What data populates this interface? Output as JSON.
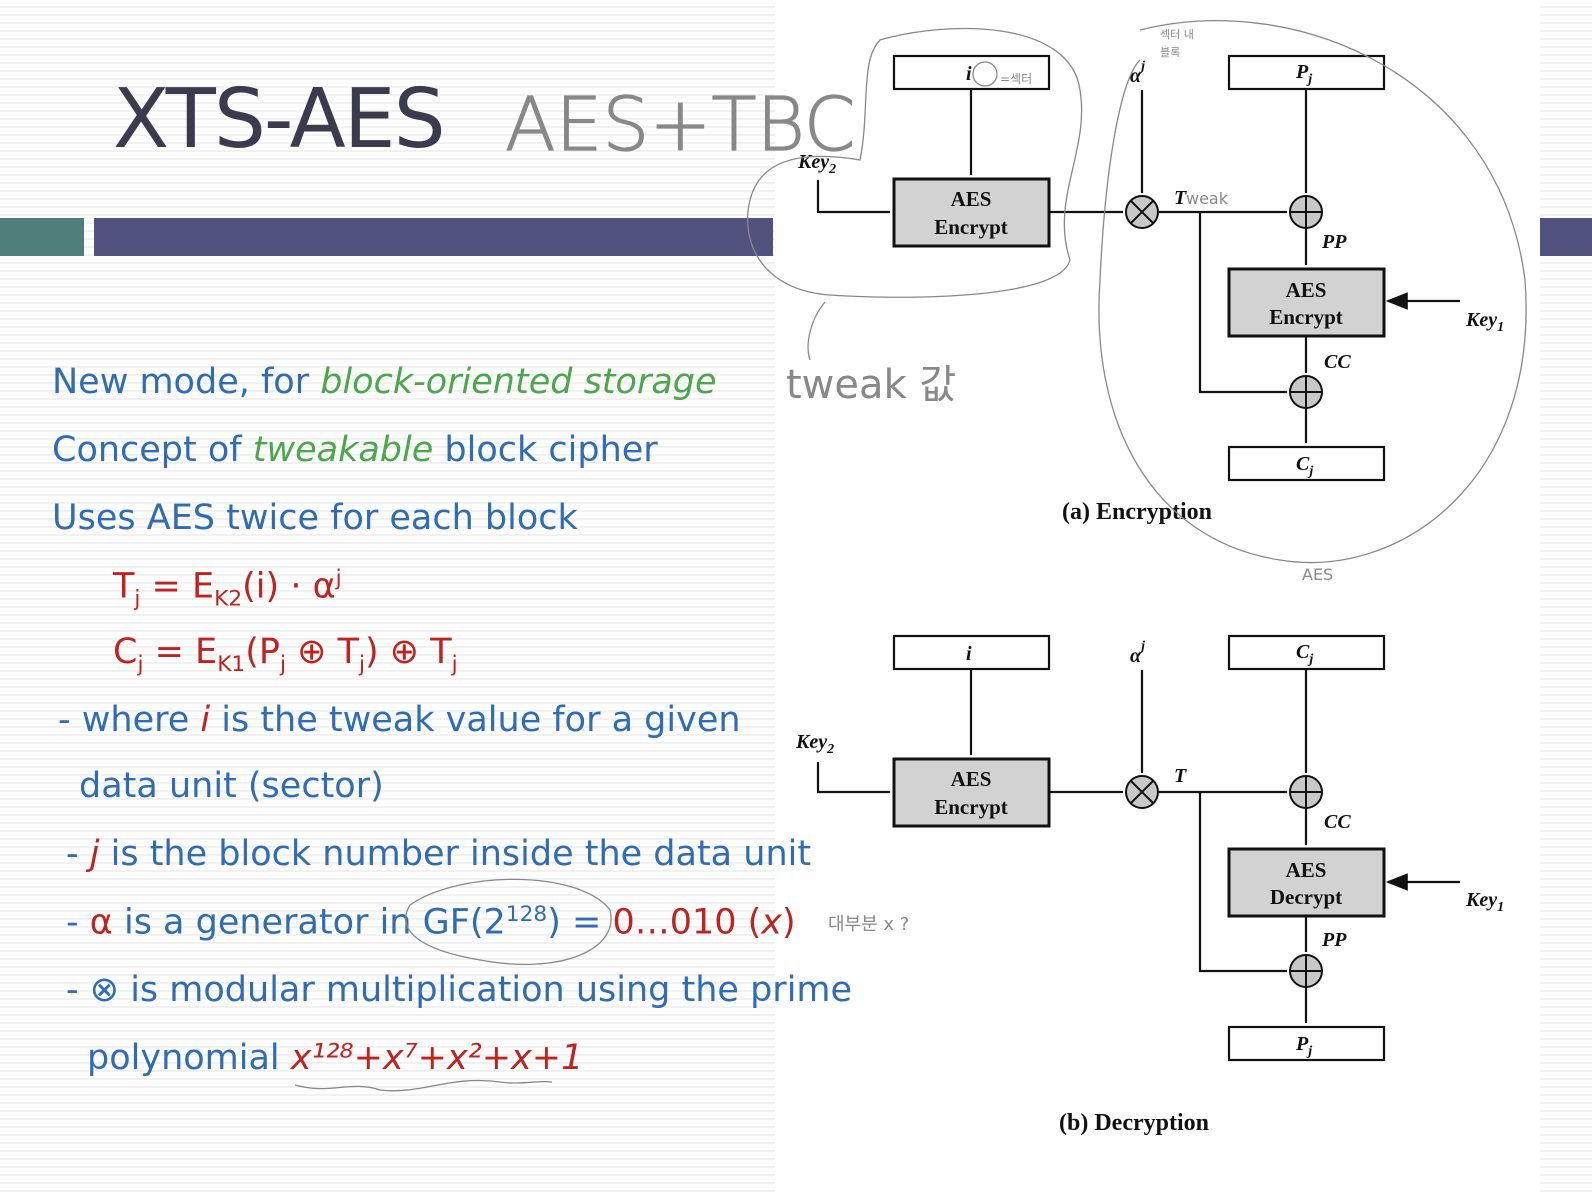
{
  "slide": {
    "title": "XTS-AES",
    "bullets": [
      {
        "a": "New mode, for ",
        "b": "block-oriented storage"
      },
      {
        "a": "Concept of ",
        "b": "tweakable",
        "c": " block cipher"
      },
      {
        "a": "Uses AES twice for each block"
      }
    ],
    "formula1": {
      "T": "T",
      "j": "j",
      "eq": " = E",
      "k": "K2",
      "rest": "(i) · α",
      "sup": "j"
    },
    "formula2": {
      "C": "C",
      "j": "j",
      "eq": " = E",
      "k": "K1",
      "p": "(P",
      "pj": "j",
      "x": " ⊕ T",
      "tj": "j",
      "close": ") ⊕ T",
      "tj2": "j"
    },
    "notes": [
      {
        "a": "- where ",
        "i": "i",
        "b": " is the tweak value for a given"
      },
      {
        "a": "data unit (sector)"
      },
      {
        "a": "- ",
        "i": "j",
        "b": " is the block number inside the data unit"
      },
      {
        "a": "- ",
        "r": "α",
        "b": " is a generator in GF(2",
        "sup": "128",
        "c": ") = ",
        "d": "0…010 (",
        "x": "x",
        "e": ")"
      },
      {
        "a": "- ⊗ is modular multiplication using the prime"
      },
      {
        "a": "polynomial ",
        "poly": "x¹²⁸+x⁷+x²+x+1"
      }
    ]
  },
  "diagram": {
    "enc": {
      "i": "i",
      "alpha": "α",
      "alpha_sup": "j",
      "pj": "P",
      "sub_j": "j",
      "key2": "Key",
      "key_sub2": "2",
      "key1": "Key",
      "key_sub1": "1",
      "aes": "AES",
      "encrypt": "Encrypt",
      "t": "T",
      "pp": "PP",
      "cc": "CC",
      "cj": "C",
      "caption": "(a) Encryption"
    },
    "dec": {
      "i": "i",
      "alpha": "α",
      "alpha_sup": "j",
      "cj": "C",
      "pj": "P",
      "sub_j": "j",
      "key2": "Key",
      "key_sub2": "2",
      "key1": "Key",
      "key_sub1": "1",
      "aes": "AES",
      "encrypt": "Encrypt",
      "decrypt": "Decrypt",
      "t": "T",
      "pp": "PP",
      "cc": "CC",
      "caption": "(b) Decryption"
    }
  },
  "handwriting": {
    "aes_tbc": "AES+TBC",
    "tweak_value": "tweak 값",
    "sector": "=섹터",
    "in_sector": "섹터 내",
    "block": "블록",
    "tweak": "weak",
    "aes": "AES",
    "mostly": "대부분 x ?"
  },
  "colors": {
    "blue": "#2e6cb5",
    "red": "#c0231e",
    "green": "#4aa84a",
    "title": "#3b3b4d",
    "bar": "#52527f",
    "teal": "#4f7f7b"
  }
}
